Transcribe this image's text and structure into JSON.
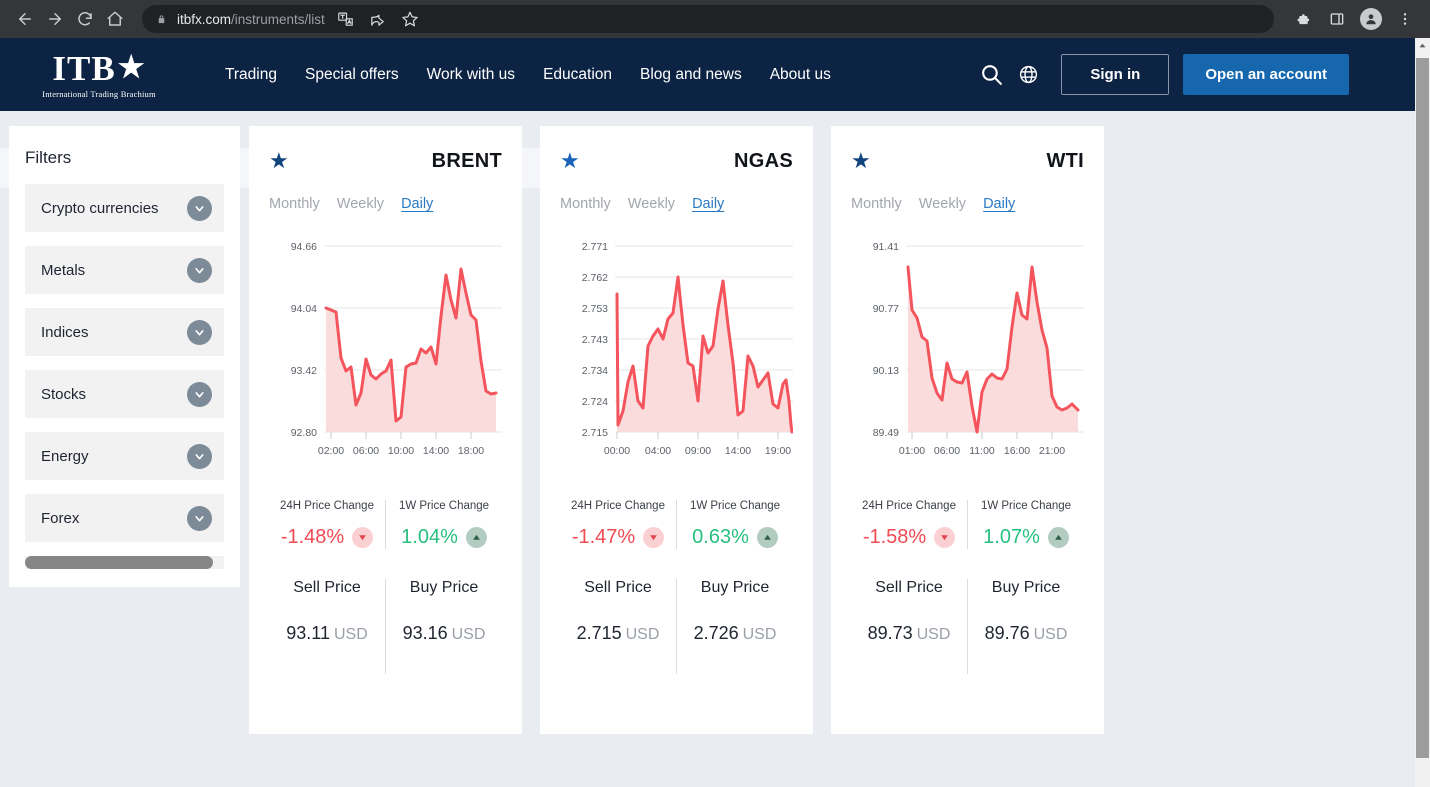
{
  "browser": {
    "url_domain": "itbfx.com",
    "url_path": "/instruments/list",
    "back_icon": "back-arrow-icon",
    "forward_icon": "forward-arrow-icon",
    "reload_icon": "reload-icon",
    "home_icon": "home-icon",
    "lock_icon": "lock-icon",
    "translate_icon": "translate-icon",
    "share_icon": "share-icon",
    "bookmark_icon": "star-outline-icon",
    "extensions_icon": "puzzle-icon",
    "sidepanel_icon": "side-panel-icon",
    "profile_icon": "profile-avatar-icon",
    "menu_icon": "three-dot-menu-icon"
  },
  "site_header": {
    "logo_text": "ITB",
    "logo_star": "★",
    "logo_subtitle": "International Trading Brachium",
    "nav": [
      {
        "label": "Trading"
      },
      {
        "label": "Special offers"
      },
      {
        "label": "Work with us"
      },
      {
        "label": "Education"
      },
      {
        "label": "Blog and news"
      },
      {
        "label": "About us"
      }
    ],
    "search_icon": "search-icon",
    "language_icon": "globe-icon",
    "sign_in_label": "Sign in",
    "open_account_label": "Open an account",
    "accent_color": "#1667ae",
    "header_bg": "#0d2343"
  },
  "filters": {
    "title": "Filters",
    "chevron_icon": "chevron-down-icon",
    "items": [
      {
        "label": "Crypto currencies"
      },
      {
        "label": "Metals"
      },
      {
        "label": "Indices"
      },
      {
        "label": "Stocks"
      },
      {
        "label": "Energy"
      },
      {
        "label": "Forex"
      }
    ]
  },
  "cards": [
    {
      "symbol": "BRENT",
      "star_icon": "star-filled-icon",
      "star_color": "#12457e",
      "tabs": [
        {
          "label": "Monthly",
          "active": false
        },
        {
          "label": "Weekly",
          "active": false
        },
        {
          "label": "Daily",
          "active": true
        }
      ],
      "change_24h_label": "24H Price Change",
      "change_24h_value": "-1.48%",
      "change_24h_direction": "down",
      "change_1w_label": "1W Price Change",
      "change_1w_value": "1.04%",
      "change_1w_direction": "up",
      "sell_label": "Sell Price",
      "sell_value": "93.11",
      "sell_currency": "USD",
      "buy_label": "Buy Price",
      "buy_value": "93.16",
      "buy_currency": "USD"
    },
    {
      "symbol": "NGAS",
      "star_icon": "star-filled-icon",
      "star_color": "#1b63b8",
      "tabs": [
        {
          "label": "Monthly",
          "active": false
        },
        {
          "label": "Weekly",
          "active": false
        },
        {
          "label": "Daily",
          "active": true
        }
      ],
      "change_24h_label": "24H Price Change",
      "change_24h_value": "-1.47%",
      "change_24h_direction": "down",
      "change_1w_label": "1W Price Change",
      "change_1w_value": "0.63%",
      "change_1w_direction": "up",
      "sell_label": "Sell Price",
      "sell_value": "2.715",
      "sell_currency": "USD",
      "buy_label": "Buy Price",
      "buy_value": "2.726",
      "buy_currency": "USD"
    },
    {
      "symbol": "WTI",
      "star_icon": "star-filled-icon",
      "star_color": "#12457e",
      "tabs": [
        {
          "label": "Monthly",
          "active": false
        },
        {
          "label": "Weekly",
          "active": false
        },
        {
          "label": "Daily",
          "active": true
        }
      ],
      "change_24h_label": "24H Price Change",
      "change_24h_value": "-1.58%",
      "change_24h_direction": "down",
      "change_1w_label": "1W Price Change",
      "change_1w_value": "1.07%",
      "change_1w_direction": "up",
      "sell_label": "Sell Price",
      "sell_value": "89.73",
      "sell_currency": "USD",
      "buy_label": "Buy Price",
      "buy_value": "89.76",
      "buy_currency": "USD"
    }
  ],
  "chart_data": [
    {
      "type": "area",
      "title": "BRENT",
      "xlabel": "",
      "ylabel": "",
      "line_color": "#f4545c",
      "fill_color": "#fbdcdd",
      "grid": true,
      "legend": "none",
      "ylim": [
        92.8,
        94.66
      ],
      "yticks": [
        92.8,
        93.42,
        94.04,
        94.66
      ],
      "ytick_labels": [
        "92.80",
        "93.42",
        "94.04",
        "94.66"
      ],
      "xticks": [
        "02:00",
        "06:00",
        "10:00",
        "14:00",
        "18:00"
      ],
      "values": [
        94.04,
        93.98,
        93.93,
        93.47,
        93.34,
        93.38,
        93.0,
        93.12,
        93.46,
        93.3,
        93.26,
        93.31,
        93.34,
        93.45,
        92.84,
        92.88,
        93.38,
        93.41,
        93.42,
        93.56,
        93.52,
        93.58,
        93.41,
        93.89,
        94.3,
        94.05,
        93.87,
        94.37,
        94.13,
        93.91,
        93.86,
        93.43,
        93.13,
        93.1,
        93.11
      ]
    },
    {
      "type": "area",
      "title": "NGAS",
      "xlabel": "",
      "ylabel": "",
      "line_color": "#f4545c",
      "fill_color": "#fbdcdd",
      "grid": true,
      "legend": "none",
      "ylim": [
        2.715,
        2.771
      ],
      "yticks": [
        2.715,
        2.724,
        2.734,
        2.743,
        2.753,
        2.762,
        2.771
      ],
      "ytick_labels": [
        "2.715",
        "2.724",
        "2.734",
        "2.743",
        "2.753",
        "2.762",
        "2.771"
      ],
      "xticks": [
        "00:00",
        "04:00",
        "09:00",
        "14:00",
        "19:00"
      ],
      "values": [
        2.757,
        2.718,
        2.722,
        2.731,
        2.736,
        2.726,
        2.724,
        2.742,
        2.745,
        2.747,
        2.744,
        2.75,
        2.752,
        2.762,
        2.75,
        2.739,
        2.738,
        2.728,
        2.742,
        2.737,
        2.739,
        2.75,
        2.761,
        2.748,
        2.738,
        2.723,
        2.724,
        2.74,
        2.738,
        2.732,
        2.734,
        2.736,
        2.727,
        2.726,
        2.733,
        2.734,
        2.728,
        2.716,
        2.715
      ]
    },
    {
      "type": "area",
      "title": "WTI",
      "xlabel": "",
      "ylabel": "",
      "line_color": "#f4545c",
      "fill_color": "#fbdcdd",
      "grid": true,
      "legend": "none",
      "ylim": [
        89.49,
        91.41
      ],
      "yticks": [
        89.49,
        90.13,
        90.77,
        91.41
      ],
      "ytick_labels": [
        "89.49",
        "90.13",
        "90.77",
        "91.41"
      ],
      "xticks": [
        "01:00",
        "06:00",
        "11:00",
        "16:00",
        "21:00"
      ],
      "values": [
        91.24,
        90.8,
        90.72,
        90.52,
        90.48,
        90.1,
        89.94,
        89.87,
        90.25,
        90.08,
        90.05,
        90.04,
        90.16,
        89.8,
        89.53,
        89.9,
        90.04,
        90.12,
        90.07,
        90.05,
        90.16,
        90.6,
        90.95,
        90.72,
        90.68,
        91.22,
        90.86,
        90.57,
        90.38,
        89.88,
        89.77,
        89.74,
        89.76,
        89.8,
        89.73
      ]
    }
  ],
  "scrollbars": {
    "vertical_up_icon": "scroll-up-arrow-icon",
    "horizontal_filter_thumb": "filters-horizontal-scroll-thumb"
  }
}
